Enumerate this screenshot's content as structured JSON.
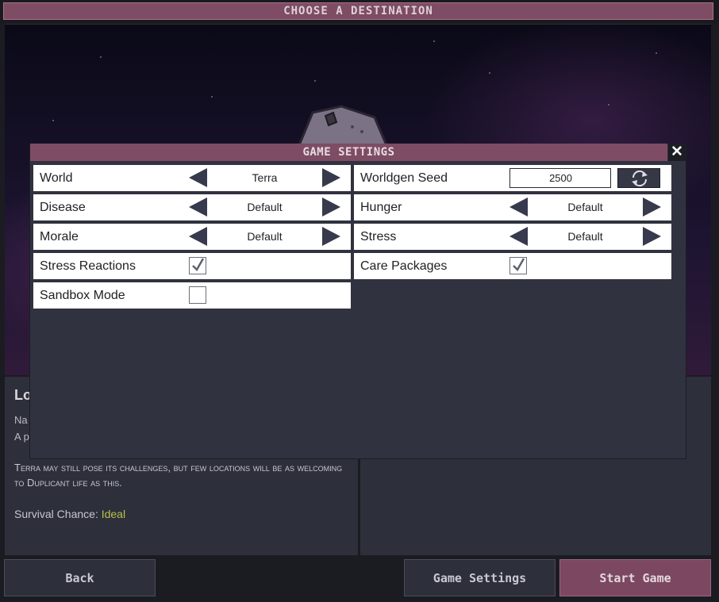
{
  "screen": {
    "title": "CHOOSE A DESTINATION"
  },
  "planet": {
    "name": "Lo",
    "line1": "Na",
    "line2": "A p",
    "description": "Terra may still pose its challenges, but few locations will be as welcoming to Duplicant life as this.",
    "survival_label": "Survival Chance:",
    "survival_value": "Ideal",
    "survival_color": "#b9c14b"
  },
  "buttons": {
    "back": "Back",
    "game_settings": "Game Settings",
    "start_game": "Start Game"
  },
  "dialog": {
    "title": "GAME SETTINGS",
    "close_icon": "close-icon",
    "world": {
      "label": "World",
      "value": "Terra"
    },
    "disease": {
      "label": "Disease",
      "value": "Default"
    },
    "morale": {
      "label": "Morale",
      "value": "Default"
    },
    "stress_reactions": {
      "label": "Stress Reactions",
      "checked": true
    },
    "sandbox_mode": {
      "label": "Sandbox Mode",
      "checked": false
    },
    "worldgen_seed": {
      "label": "Worldgen Seed",
      "value": "2500",
      "refresh_icon": "refresh-icon"
    },
    "hunger": {
      "label": "Hunger",
      "value": "Default"
    },
    "stress": {
      "label": "Stress",
      "value": "Default"
    },
    "care_packages": {
      "label": "Care Packages",
      "checked": true
    }
  },
  "colors": {
    "accent": "#7e4c64",
    "panel": "#2d2f3b",
    "arrow": "#373a4c"
  }
}
